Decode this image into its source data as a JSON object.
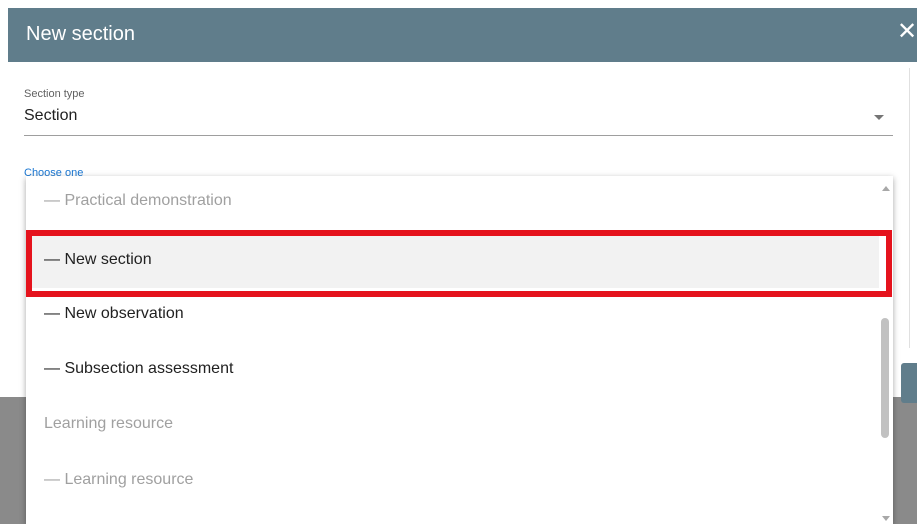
{
  "dialog": {
    "title": "New section",
    "close_glyph": "✕"
  },
  "section_type": {
    "label": "Section type",
    "value": "Section"
  },
  "choose": {
    "label": "Choose one"
  },
  "dropdown": {
    "options": [
      {
        "label": "— Practical demonstration",
        "enabled": false,
        "highlighted": false
      },
      {
        "label": "— New section",
        "enabled": true,
        "highlighted": true
      },
      {
        "label": "— New observation",
        "enabled": true,
        "highlighted": false
      },
      {
        "label": "— Subsection assessment",
        "enabled": true,
        "highlighted": false
      },
      {
        "label": "Learning resource",
        "enabled": false,
        "highlighted": false
      },
      {
        "label": "— Learning resource",
        "enabled": false,
        "highlighted": false
      }
    ]
  },
  "icons": {
    "close": "close-icon",
    "dropdown_arrow": "chevron-down-icon",
    "scroll_up": "scroll-up-icon",
    "scroll_down": "scroll-down-icon"
  },
  "colors": {
    "header": "#607d8b",
    "accent": "#1976d2",
    "highlight_border": "#e5131d"
  }
}
